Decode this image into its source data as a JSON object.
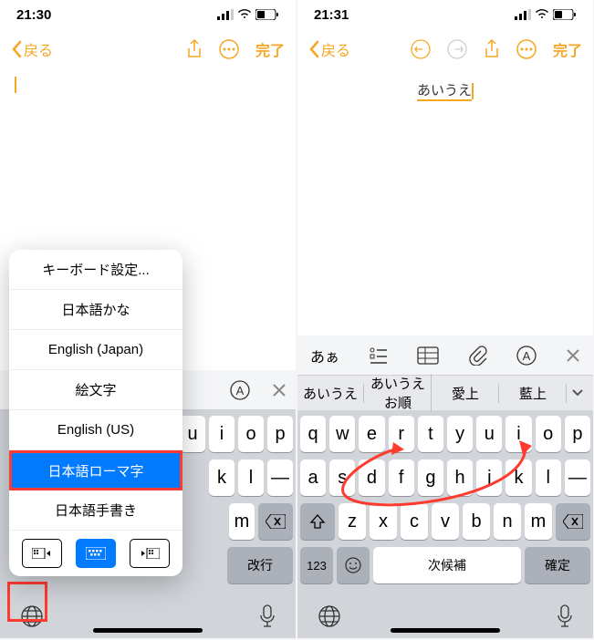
{
  "left": {
    "status_time": "21:30",
    "nav_back": "戻る",
    "nav_done": "完了",
    "kbd_popup": {
      "items": [
        "キーボード設定...",
        "日本語かな",
        "English (Japan)",
        "絵文字",
        "English (US)",
        "日本語ローマ字",
        "日本語手書き"
      ]
    },
    "keys_row1": [
      "u",
      "i",
      "o",
      "p"
    ],
    "keys_row2": [
      "k",
      "l",
      "—"
    ],
    "key_kaigyou": "改行"
  },
  "right": {
    "status_time": "21:31",
    "nav_back": "戻る",
    "nav_done": "完了",
    "typed": "あいうえ",
    "toolbar_aa": "あぁ",
    "suggestions": [
      "あいうえ",
      "あいうえお順",
      "愛上",
      "藍上"
    ],
    "keys_row1": [
      "q",
      "w",
      "e",
      "r",
      "t",
      "y",
      "u",
      "i",
      "o",
      "p"
    ],
    "keys_row2": [
      "a",
      "s",
      "d",
      "f",
      "g",
      "h",
      "j",
      "k",
      "l",
      "—"
    ],
    "keys_row3": [
      "z",
      "x",
      "c",
      "v",
      "b",
      "n",
      "m"
    ],
    "key_123": "123",
    "key_jikouho": "次候補",
    "key_kakutei": "確定"
  }
}
